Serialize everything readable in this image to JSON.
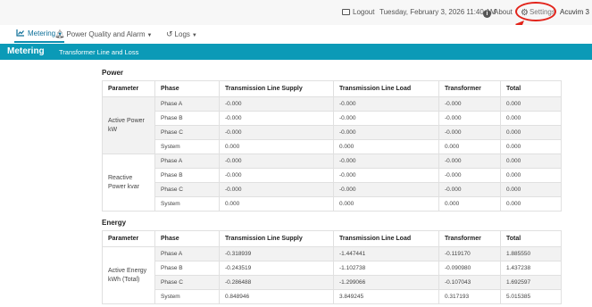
{
  "topbar": {
    "logout_label": "Logout",
    "datetime": "Tuesday, February 3, 2026 11:40 AM",
    "about_label": "About",
    "settings_label": "Settings",
    "brand": "Acuvim 3"
  },
  "nav": {
    "metering": "Metering",
    "power_quality": "Power Quality and Alarm",
    "logs": "Logs"
  },
  "banner": {
    "title": "Metering",
    "subtitle": "Transformer Line and Loss"
  },
  "power": {
    "title": "Power",
    "headers": [
      "Parameter",
      "Phase",
      "Transmission Line Supply",
      "Transmission Line Load",
      "Transformer",
      "Total"
    ],
    "groups": [
      {
        "label": "Active Power kW",
        "rows": [
          [
            "Phase A",
            "-0.000",
            "-0.000",
            "-0.000",
            "0.000"
          ],
          [
            "Phase B",
            "-0.000",
            "-0.000",
            "-0.000",
            "0.000"
          ],
          [
            "Phase C",
            "-0.000",
            "-0.000",
            "-0.000",
            "0.000"
          ],
          [
            "System",
            "0.000",
            "0.000",
            "0.000",
            "0.000"
          ]
        ]
      },
      {
        "label": "Reactive Power kvar",
        "rows": [
          [
            "Phase A",
            "-0.000",
            "-0.000",
            "-0.000",
            "0.000"
          ],
          [
            "Phase B",
            "-0.000",
            "-0.000",
            "-0.000",
            "0.000"
          ],
          [
            "Phase C",
            "-0.000",
            "-0.000",
            "-0.000",
            "0.000"
          ],
          [
            "System",
            "0.000",
            "0.000",
            "0.000",
            "0.000"
          ]
        ]
      }
    ]
  },
  "energy": {
    "title": "Energy",
    "headers": [
      "Parameter",
      "Phase",
      "Transmission Line Supply",
      "Transmission Line Load",
      "Transformer",
      "Total"
    ],
    "groups": [
      {
        "label": "Active Energy kWh (Total)",
        "rows": [
          [
            "Phase A",
            "-0.318939",
            "-1.447441",
            "-0.119170",
            "1.885550"
          ],
          [
            "Phase B",
            "-0.243519",
            "-1.102738",
            "-0.090980",
            "1.437238"
          ],
          [
            "Phase C",
            "-0.286488",
            "-1.299066",
            "-0.107043",
            "1.692597"
          ],
          [
            "System",
            "0.848946",
            "3.849245",
            "0.317193",
            "5.015385"
          ]
        ]
      }
    ]
  }
}
